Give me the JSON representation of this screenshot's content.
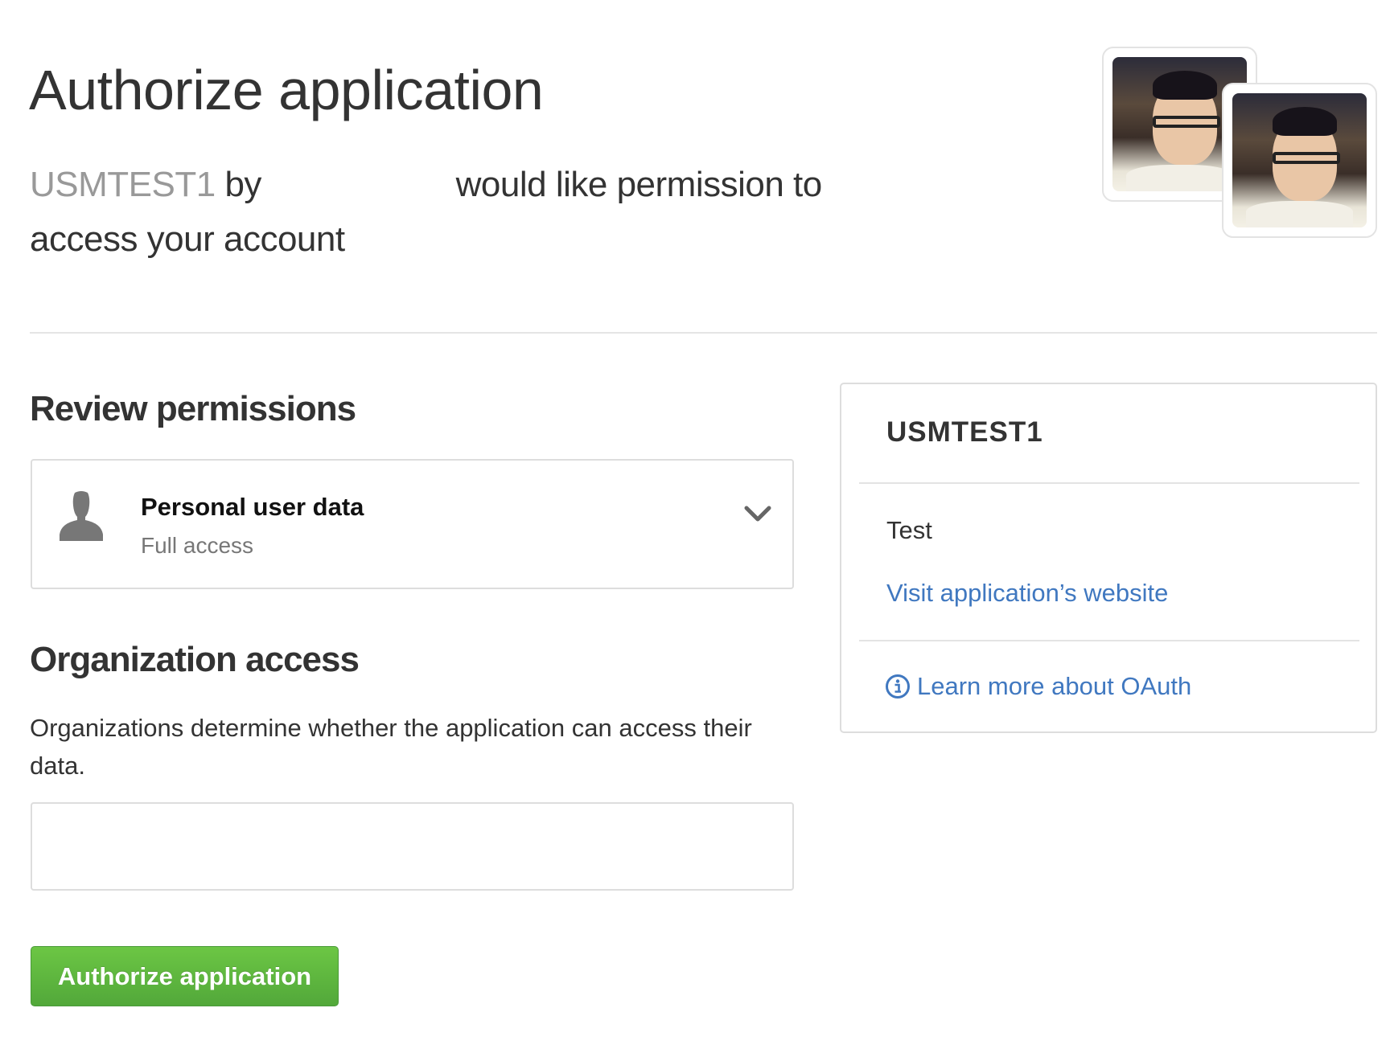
{
  "header": {
    "title": "Authorize application",
    "app_name": "USMTEST1",
    "by": "by",
    "request_text": "would like permission to access your account"
  },
  "permissions": {
    "heading": "Review permissions",
    "items": [
      {
        "title": "Personal user data",
        "access": "Full access",
        "icon": "user-icon"
      }
    ]
  },
  "organization": {
    "heading": "Organization access",
    "description": "Organizations determine whether the application can access their data."
  },
  "actions": {
    "authorize_label": "Authorize application"
  },
  "sidebar": {
    "app_name": "USMTEST1",
    "description": "Test",
    "website_link": "Visit application’s website",
    "learn_link": "Learn more about OAuth"
  },
  "colors": {
    "accent": "#4078c0",
    "button": "#60b044"
  }
}
